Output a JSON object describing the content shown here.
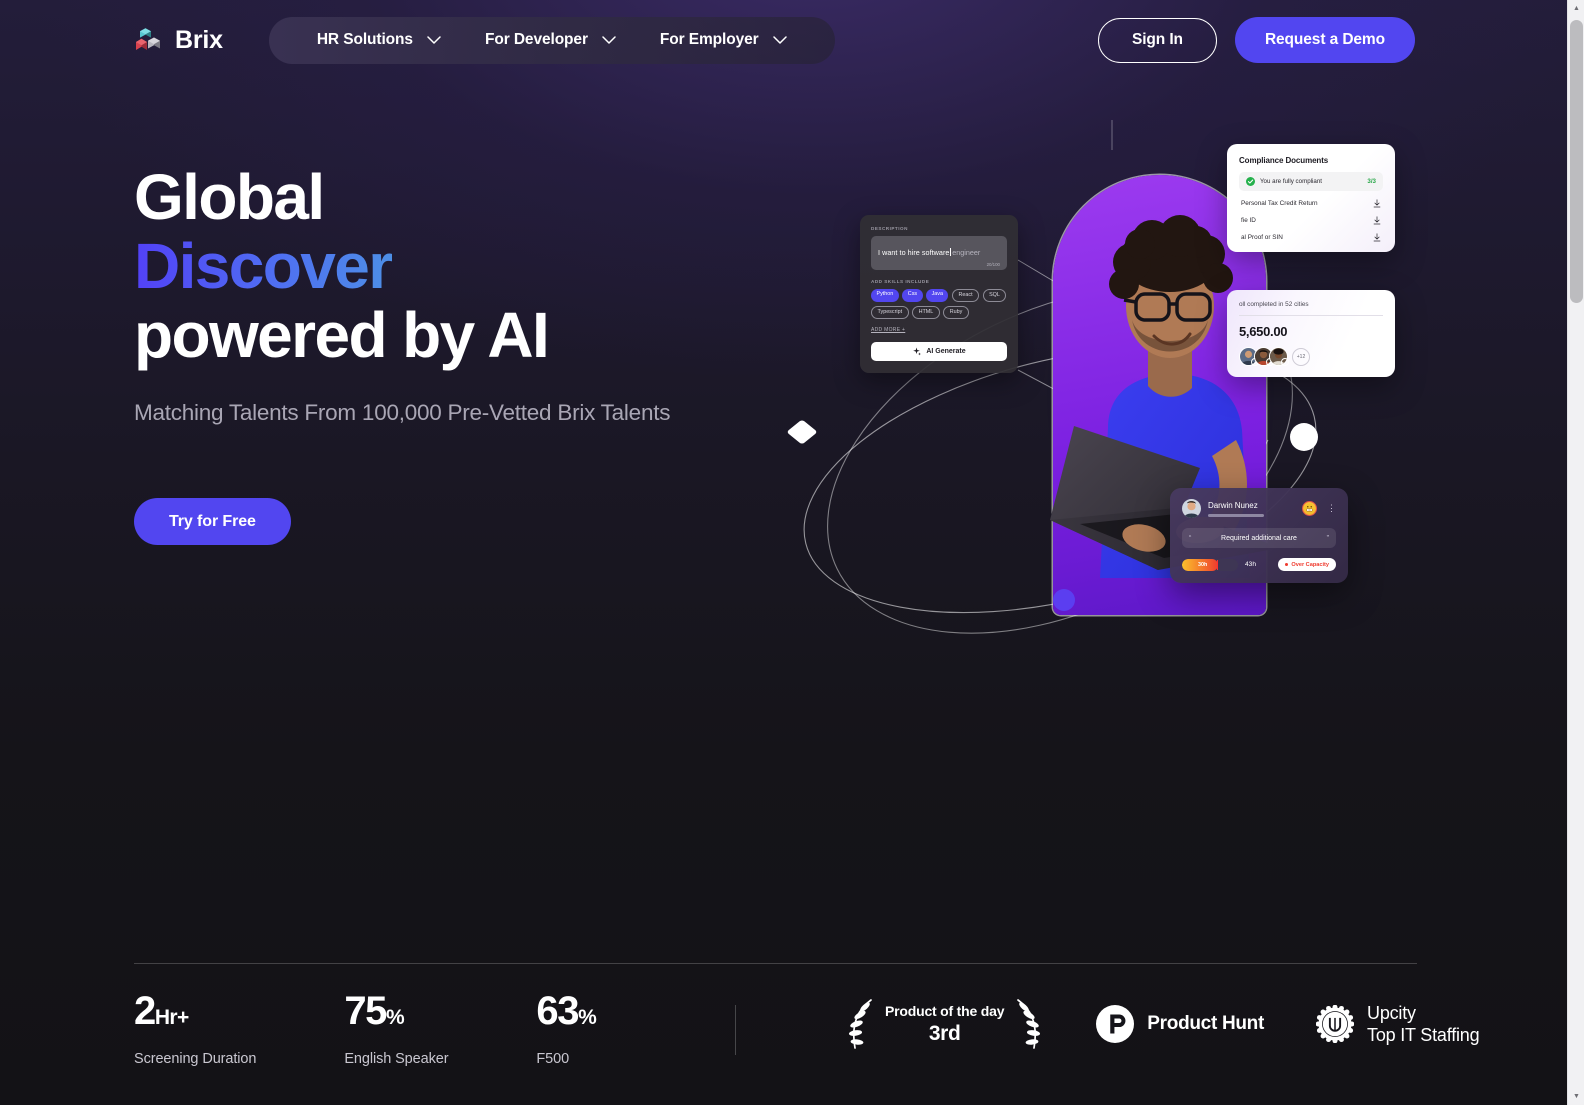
{
  "brand": {
    "name": "Brix",
    "logo_icon": "brix-cubes-logo"
  },
  "nav": {
    "items": [
      {
        "label": "HR Solutions",
        "icon": "chevron-down-icon"
      },
      {
        "label": "For Developer",
        "icon": "chevron-down-icon"
      },
      {
        "label": "For Employer",
        "icon": "chevron-down-icon"
      }
    ],
    "sign_in": "Sign In",
    "request_demo": "Request a Demo"
  },
  "hero": {
    "line1": "Global",
    "line2": "Discover",
    "line3": "powered by AI",
    "subtitle": "Matching Talents From 100,000 Pre-Vetted Brix Talents",
    "cta": "Try for Free",
    "accent_gradient_from": "#5241f7",
    "accent_gradient_to": "#4d8fe6",
    "primary_color": "#5246f0"
  },
  "ai_card": {
    "description_label": "DESCRIPTION",
    "typed_text": "I want to hire software",
    "ghost_text": "engineer",
    "char_count": "20/100",
    "skills_label": "ADD SKILLS INCLUDE",
    "chips": [
      {
        "label": "Python",
        "selected": true
      },
      {
        "label": "Css",
        "selected": true
      },
      {
        "label": "Java",
        "selected": true
      },
      {
        "label": "React",
        "selected": false
      },
      {
        "label": "SQL",
        "selected": false
      },
      {
        "label": "Typescript",
        "selected": false
      },
      {
        "label": "HTML",
        "selected": false
      },
      {
        "label": "Ruby",
        "selected": false
      }
    ],
    "add_more": "ADD MORE +",
    "generate_button": "AI Generate",
    "generate_icon": "sparkles-icon"
  },
  "compliance_card": {
    "title": "Compliance Documents",
    "status_text": "You are fully compliant",
    "status_count": "3/3",
    "status_icon": "check-circle-icon",
    "documents": [
      {
        "name": "Personal Tax Credit Return",
        "icon": "download-icon"
      },
      {
        "name": "fie ID",
        "icon": "download-icon"
      },
      {
        "name": "al Proof or SIN",
        "icon": "download-icon"
      }
    ]
  },
  "payroll_card": {
    "headline": "oll completed in 52 cities",
    "amount": "5,650.00",
    "more_count": "+12",
    "avatars": [
      {
        "flag": "uk-flag-icon"
      },
      {
        "flag": "canada-flag-icon"
      },
      {
        "flag": "usa-flag-icon"
      }
    ]
  },
  "person_card": {
    "name": "Darwin Nunez",
    "avatar_icon": "avatar",
    "mood_icon": "grimacing-face-emoji",
    "menu_icon": "kebab-menu-icon",
    "quote": "Required additional care",
    "quote_open_icon": "quote-open-icon",
    "quote_close_icon": "quote-close-icon",
    "hours_done": "30h",
    "hours_total": "43h",
    "status_badge": "Over Capacity",
    "status_color": "#ef3b2f"
  },
  "stats": [
    {
      "value": "2",
      "unit": "Hr+",
      "label": "Screening Duration"
    },
    {
      "value": "75",
      "unit": "%",
      "label": "English Speaker"
    },
    {
      "value": "63",
      "unit": "%",
      "label": "F500"
    }
  ],
  "awards": {
    "product_of_the_day": {
      "top": "Product of the day",
      "rank": "3rd",
      "icon": "laurel-wreath-icon"
    },
    "product_hunt": {
      "label": "Product Hunt",
      "icon": "product-hunt-icon"
    },
    "upcity": {
      "line1": "Upcity",
      "line2": "Top IT Staffing",
      "icon": "upcity-seal-icon"
    }
  }
}
